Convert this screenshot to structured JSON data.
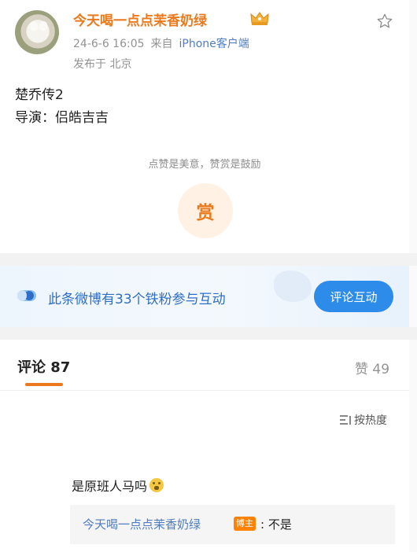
{
  "post": {
    "username": "今天喝一点点茉香奶绿",
    "time": "24-6-6 16:05",
    "source_prefix": "来自",
    "source": "iPhone客户端",
    "location": "发布于 北京",
    "content_lines": [
      "楚乔传2",
      "导演：侣皓吉吉"
    ],
    "reward_text": "点赞是美意，赞赏是鼓励",
    "reward_button": "赏"
  },
  "fans_banner": {
    "text": "此条微博有33个铁粉参与互动",
    "button": "评论互动"
  },
  "tabs": {
    "comments": "评论 87",
    "likes": "赞 49"
  },
  "sort_label": "按热度",
  "comment": {
    "text": "是原班人马吗",
    "reply_user": "今天喝一点点茉香奶绿",
    "reply_badge": "博主",
    "reply_text": ": 不是"
  },
  "colors": {
    "accent_orange": "#ea7a1d",
    "link_blue": "#4f7cc3",
    "button_blue": "#2d8cea"
  }
}
